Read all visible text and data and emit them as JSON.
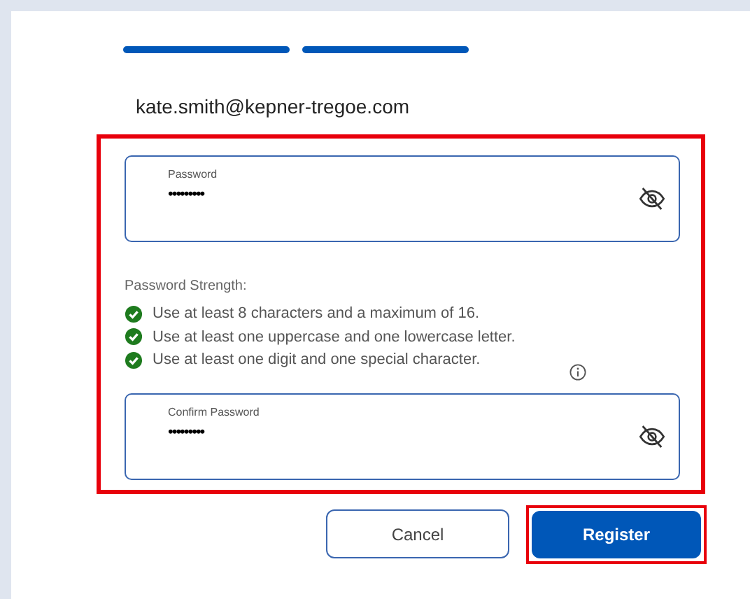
{
  "progress_steps": [
    {
      "completed": true
    },
    {
      "completed": true
    }
  ],
  "email": "kate.smith@kepner-tregoe.com",
  "password_section": {
    "highlighted": true,
    "password_field": {
      "label": "Password",
      "value": "•••••••••"
    },
    "strength": {
      "title": "Password Strength:",
      "rules": [
        {
          "text": "Use at least 8 characters and a maximum of 16.",
          "met": true
        },
        {
          "text": "Use at least one uppercase and one lowercase letter.",
          "met": true
        },
        {
          "text": "Use at least one digit and one special character.",
          "met": true
        }
      ]
    },
    "confirm_field": {
      "label": "Confirm Password",
      "value": "•••••••••"
    }
  },
  "buttons": [
    {
      "label": "Cancel",
      "kind": "secondary",
      "highlighted": false
    },
    {
      "label": "Register",
      "kind": "primary",
      "highlighted": true
    }
  ]
}
